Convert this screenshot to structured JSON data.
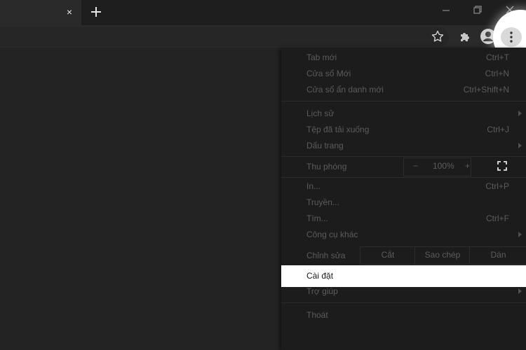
{
  "browser": {
    "tab_close": "×",
    "icons": {
      "new_tab": "plus-icon",
      "minimize": "minimize-icon",
      "restore": "restore-icon",
      "close": "close-icon",
      "bookmark": "star-icon",
      "extensions": "puzzle-icon",
      "profile": "profile-icon",
      "menu": "kebab-menu-icon"
    }
  },
  "menu": {
    "items": [
      {
        "label": "Tab mới",
        "shortcut": "Ctrl+T"
      },
      {
        "label": "Cửa sổ Mới",
        "shortcut": "Ctrl+N"
      },
      {
        "label": "Cửa sổ ẩn danh mới",
        "shortcut": "Ctrl+Shift+N"
      },
      {
        "label": "Lịch sử",
        "shortcut": ""
      },
      {
        "label": "Tệp đã tải xuống",
        "shortcut": "Ctrl+J"
      },
      {
        "label": "Dấu trang",
        "shortcut": ""
      },
      {
        "label": "In...",
        "shortcut": "Ctrl+P"
      },
      {
        "label": "Truyền...",
        "shortcut": ""
      },
      {
        "label": "Tìm...",
        "shortcut": "Ctrl+F"
      },
      {
        "label": "Công cụ khác",
        "shortcut": ""
      },
      {
        "label": "Trợ giúp",
        "shortcut": ""
      },
      {
        "label": "Thoát",
        "shortcut": ""
      }
    ],
    "zoom": {
      "label": "Thu phóng",
      "minus": "−",
      "value": "100%",
      "plus": "+"
    },
    "edit": {
      "label": "Chỉnh sửa",
      "cut": "Cắt",
      "copy": "Sao chép",
      "paste": "Dán"
    },
    "settings": {
      "label": "Cài đặt"
    }
  }
}
